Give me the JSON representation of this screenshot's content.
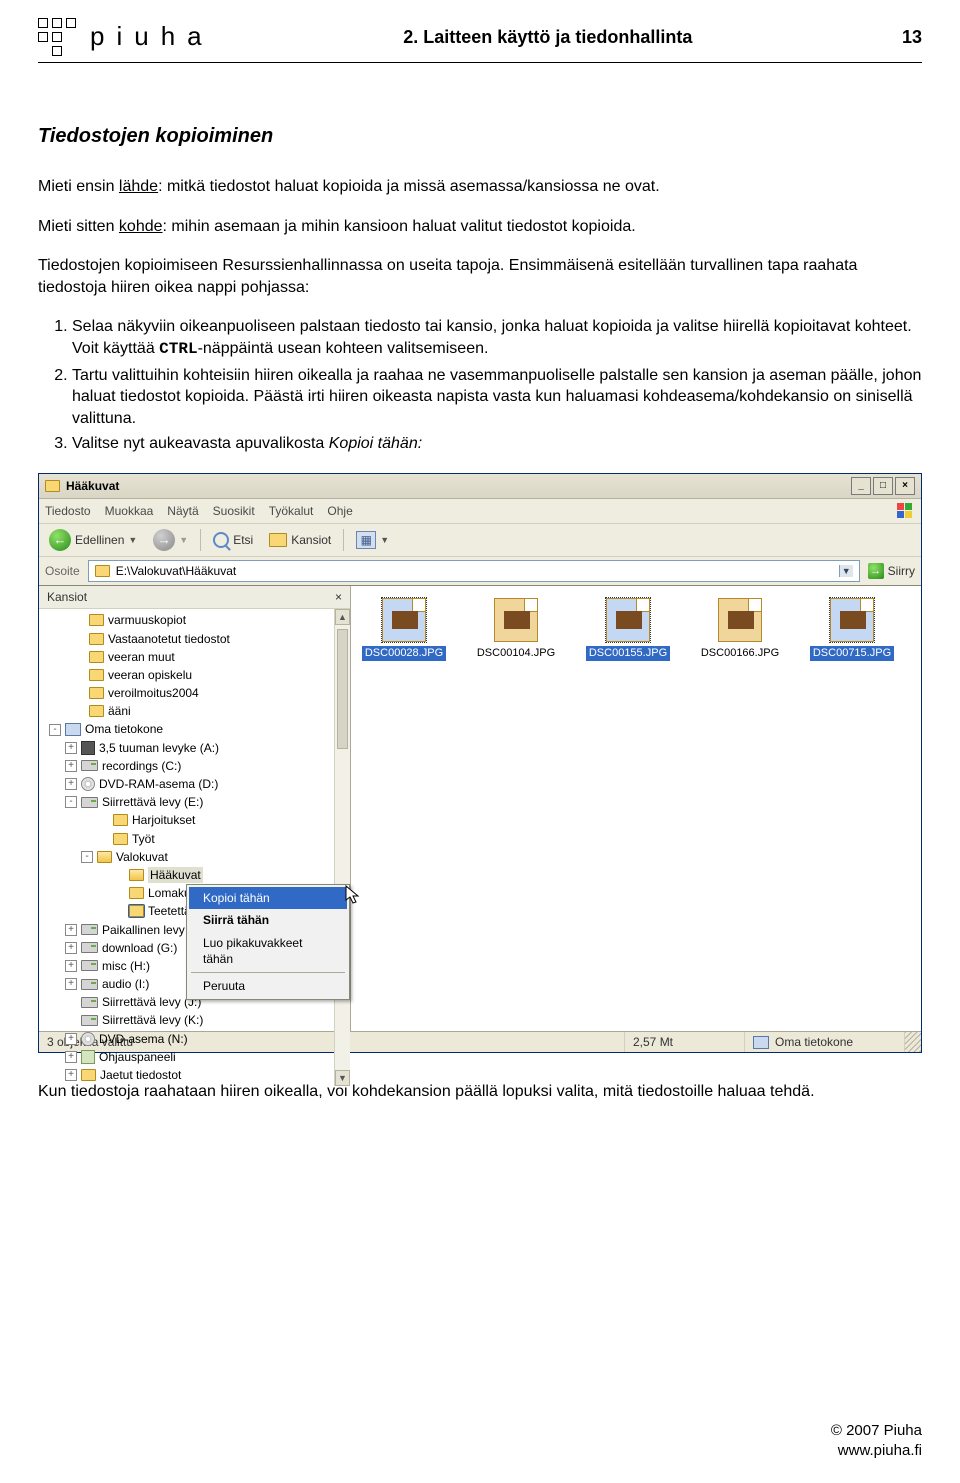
{
  "header": {
    "brand": "piuha",
    "chapter": "2. Laitteen käyttö ja tiedonhallinta",
    "page": "13"
  },
  "section_title": "Tiedostojen kopioiminen",
  "p1_a": "Mieti ensin ",
  "p1_b": "lähde",
  "p1_c": ": mitkä tiedostot haluat kopioida ja missä asemassa/kansiossa ne ovat.",
  "p2_a": "Mieti sitten ",
  "p2_b": "kohde",
  "p2_c": ": mihin asemaan ja mihin kansioon haluat valitut tiedostot kopioida.",
  "p3": "Tiedostojen kopioimiseen Resurssienhallinnassa on useita tapoja. Ensimmäisenä esitellään turvallinen tapa raahata tiedostoja hiiren oikea nappi pohjassa:",
  "li1_a": "Selaa näkyviin oikeanpuoliseen palstaan tiedosto tai kansio, jonka haluat kopioida ja valitse hiirellä kopioitavat kohteet. Voit käyttää ",
  "li1_b": "CTRL",
  "li1_c": "-näppäintä usean kohteen valitsemiseen.",
  "li2": "Tartu valittuihin kohteisiin hiiren oikealla ja raahaa ne vasemmanpuoliselle palstalle sen kansion ja aseman päälle, johon haluat tiedostot kopioida. Päästä irti hiiren oikeasta napista vasta kun haluamasi kohdeasema/kohdekansio on sinisellä valittuna.",
  "li3_a": "Valitse nyt aukeavasta apuvalikosta ",
  "li3_b": "Kopioi tähän:",
  "after_para": "Kun tiedostoja raahataan hiiren oikealla, voi kohdekansion päällä lopuksi valita, mitä tiedostoille haluaa tehdä.",
  "footer": {
    "copyright": "© 2007 Piuha",
    "url": "www.piuha.fi"
  },
  "shot": {
    "title": "Hääkuvat",
    "menubar": [
      "Tiedosto",
      "Muokkaa",
      "Näytä",
      "Suosikit",
      "Työkalut",
      "Ohje"
    ],
    "toolbar": {
      "back": "Edellinen",
      "search": "Etsi",
      "folders": "Kansiot"
    },
    "address": {
      "label": "Osoite",
      "path": "E:\\Valokuvat\\Hääkuvat",
      "go": "Siirry"
    },
    "folders_hdr": "Kansiot",
    "tree": [
      {
        "ind": 30,
        "exp": "",
        "ico": "folder",
        "label": "varmuuskopiot"
      },
      {
        "ind": 30,
        "exp": "",
        "ico": "folder",
        "label": "Vastaanotetut tiedostot"
      },
      {
        "ind": 30,
        "exp": "",
        "ico": "folder",
        "label": "veeran muut"
      },
      {
        "ind": 30,
        "exp": "",
        "ico": "folder",
        "label": "veeran opiskelu"
      },
      {
        "ind": 30,
        "exp": "",
        "ico": "folder",
        "label": "veroilmoitus2004"
      },
      {
        "ind": 30,
        "exp": "",
        "ico": "folder",
        "label": "ääni"
      },
      {
        "ind": 6,
        "exp": "-",
        "ico": "computer",
        "label": "Oma tietokone"
      },
      {
        "ind": 22,
        "exp": "+",
        "ico": "floppy",
        "label": "3,5 tuuman levyke (A:)"
      },
      {
        "ind": 22,
        "exp": "+",
        "ico": "drive",
        "label": "recordings (C:)"
      },
      {
        "ind": 22,
        "exp": "+",
        "ico": "cd",
        "label": "DVD-RAM-asema (D:)"
      },
      {
        "ind": 22,
        "exp": "-",
        "ico": "drive",
        "label": "Siirrettävä levy (E:)"
      },
      {
        "ind": 54,
        "exp": "",
        "ico": "folder",
        "label": "Harjoitukset"
      },
      {
        "ind": 54,
        "exp": "",
        "ico": "folder",
        "label": "Työt"
      },
      {
        "ind": 38,
        "exp": "-",
        "ico": "folder-open",
        "label": "Valokuvat"
      },
      {
        "ind": 70,
        "exp": "",
        "ico": "folder-open",
        "label": "Hääkuvat",
        "hl": true
      },
      {
        "ind": 70,
        "exp": "",
        "ico": "folder",
        "label": "Lomakuvat Madeiralta"
      },
      {
        "ind": 70,
        "exp": "",
        "ico": "folder",
        "label": "Teetettävät kuvat",
        "sel": true
      },
      {
        "ind": 22,
        "exp": "+",
        "ico": "drive",
        "label": "Paikallinen levy (F:)"
      },
      {
        "ind": 22,
        "exp": "+",
        "ico": "drive",
        "label": "download (G:)"
      },
      {
        "ind": 22,
        "exp": "+",
        "ico": "drive",
        "label": "misc (H:)"
      },
      {
        "ind": 22,
        "exp": "+",
        "ico": "drive",
        "label": "audio (I:)"
      },
      {
        "ind": 22,
        "exp": "",
        "ico": "drive",
        "label": "Siirrettävä levy (J:)"
      },
      {
        "ind": 22,
        "exp": "",
        "ico": "drive",
        "label": "Siirrettävä levy (K:)"
      },
      {
        "ind": 22,
        "exp": "+",
        "ico": "cd",
        "label": "DVD-asema (N:)"
      },
      {
        "ind": 22,
        "exp": "+",
        "ico": "panel",
        "label": "Ohjauspaneeli"
      },
      {
        "ind": 22,
        "exp": "+",
        "ico": "folder",
        "label": "Jaetut tiedostot"
      }
    ],
    "files": [
      {
        "name": "DSC00028.JPG",
        "sel": true
      },
      {
        "name": "DSC00104.JPG",
        "sel": false
      },
      {
        "name": "DSC00155.JPG",
        "sel": true
      },
      {
        "name": "DSC00166.JPG",
        "sel": false
      },
      {
        "name": "DSC00715.JPG",
        "sel": true
      }
    ],
    "context_menu": [
      {
        "label": "Kopioi tähän",
        "hl": true
      },
      {
        "label": "Siirrä tähän",
        "bold": true
      },
      {
        "label": "Luo pikakuvakkeet tähän"
      },
      {
        "sep": true
      },
      {
        "label": "Peruuta"
      }
    ],
    "status": {
      "left": "3 objektia valittu",
      "mid": "2,57 Mt",
      "right": "Oma tietokone"
    }
  }
}
